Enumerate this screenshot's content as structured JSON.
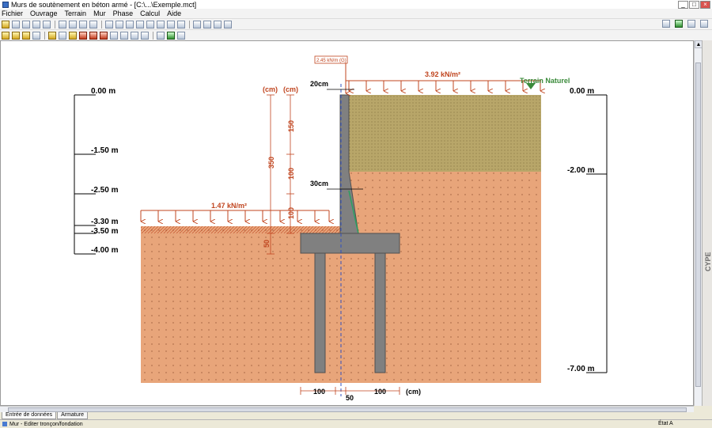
{
  "window": {
    "title": "Murs de soutènement en béton armé - [C:\\...\\Exemple.mct]"
  },
  "menu": [
    "Fichier",
    "Ouvrage",
    "Terrain",
    "Mur",
    "Phase",
    "Calcul",
    "Aide"
  ],
  "drawing": {
    "depth_left": [
      "0.00 m",
      "-1.50 m",
      "-2.50 m",
      "-3.30 m",
      "-3.50 m",
      "-4.00 m"
    ],
    "depth_right": [
      "0.00 m",
      "-2.00 m",
      "-7.00 m"
    ],
    "load_point": "2.45 kN/m (G)",
    "load_top": "3.92 kN/m²",
    "load_front": "1.47 kN/m²",
    "terrain_label": "Terrain Naturel",
    "dim_top_thickness": "20cm",
    "dim_base_thickness": "30cm",
    "unit_cm": "(cm)",
    "dim_total_height": "350",
    "dim_segments": [
      "150",
      "100",
      "100"
    ],
    "dim_foundation": "50",
    "dim_bottom": [
      "100",
      "50",
      "100"
    ],
    "colors": {
      "soil": "#e8a57a",
      "backfill": "#b8a669",
      "concrete": "#808080",
      "load": "#c0451f",
      "terrain": "#3a8a3a"
    }
  },
  "tabs": [
    "Entrée de données",
    "Armature"
  ],
  "status": {
    "left": "Mur - Editer tronçon/fondation",
    "right": "État A"
  },
  "side_label": "CYPE"
}
